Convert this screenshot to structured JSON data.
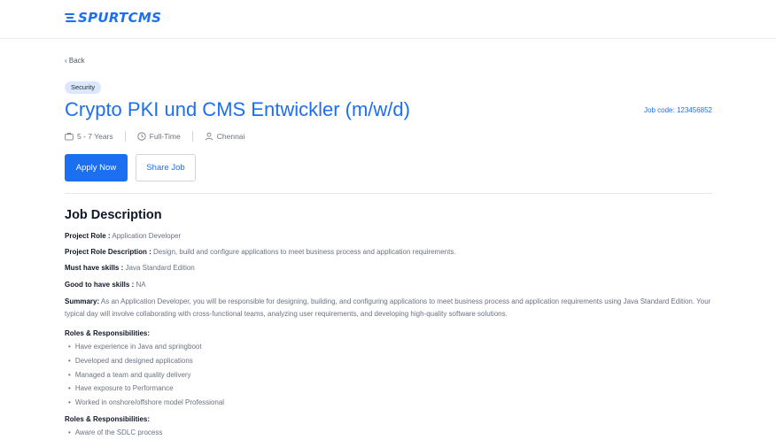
{
  "brand": {
    "name": "SPURTCMS",
    "color": "#1d6ff2"
  },
  "nav": {
    "back_label": "‹ Back"
  },
  "job": {
    "tag": "Security",
    "title": "Crypto PKI und CMS Entwickler (m/w/d)",
    "job_code": "Job code: 123456852",
    "meta": {
      "experience": "5 - 7 Years",
      "type": "Full-Time",
      "location": "Chennai"
    },
    "apply_label": "Apply Now",
    "share_label": "Share Job"
  },
  "description": {
    "heading": "Job Description",
    "fields": [
      {
        "label": "Project Role :",
        "value": "Application Developer"
      },
      {
        "label": "Project Role Description :",
        "value": "Design, build and configure applications to meet business process and application requirements."
      },
      {
        "label": "Must have skills :",
        "value": "Java Standard Edition"
      },
      {
        "label": "Good to have skills :",
        "value": "NA"
      }
    ],
    "summary_label": "Summary:",
    "summary_text": "As an Application Developer, you will be responsible for designing, building, and configuring applications to meet business process and application requirements using Java Standard Edition. Your typical day will involve collaborating with cross-functional teams, analyzing user requirements, and developing high-quality software solutions.",
    "sections": [
      {
        "heading": "Roles & Responsibilities:",
        "items": [
          "Have experience in Java and springboot",
          "Developed and designed applications",
          "Managed a team and quality delivery",
          "Have exposure to Performance",
          "Worked in onshore/offshore model Professional"
        ]
      },
      {
        "heading": "Roles & Responsibilities:",
        "items": [
          "Aware of the SDLC process"
        ]
      }
    ]
  }
}
